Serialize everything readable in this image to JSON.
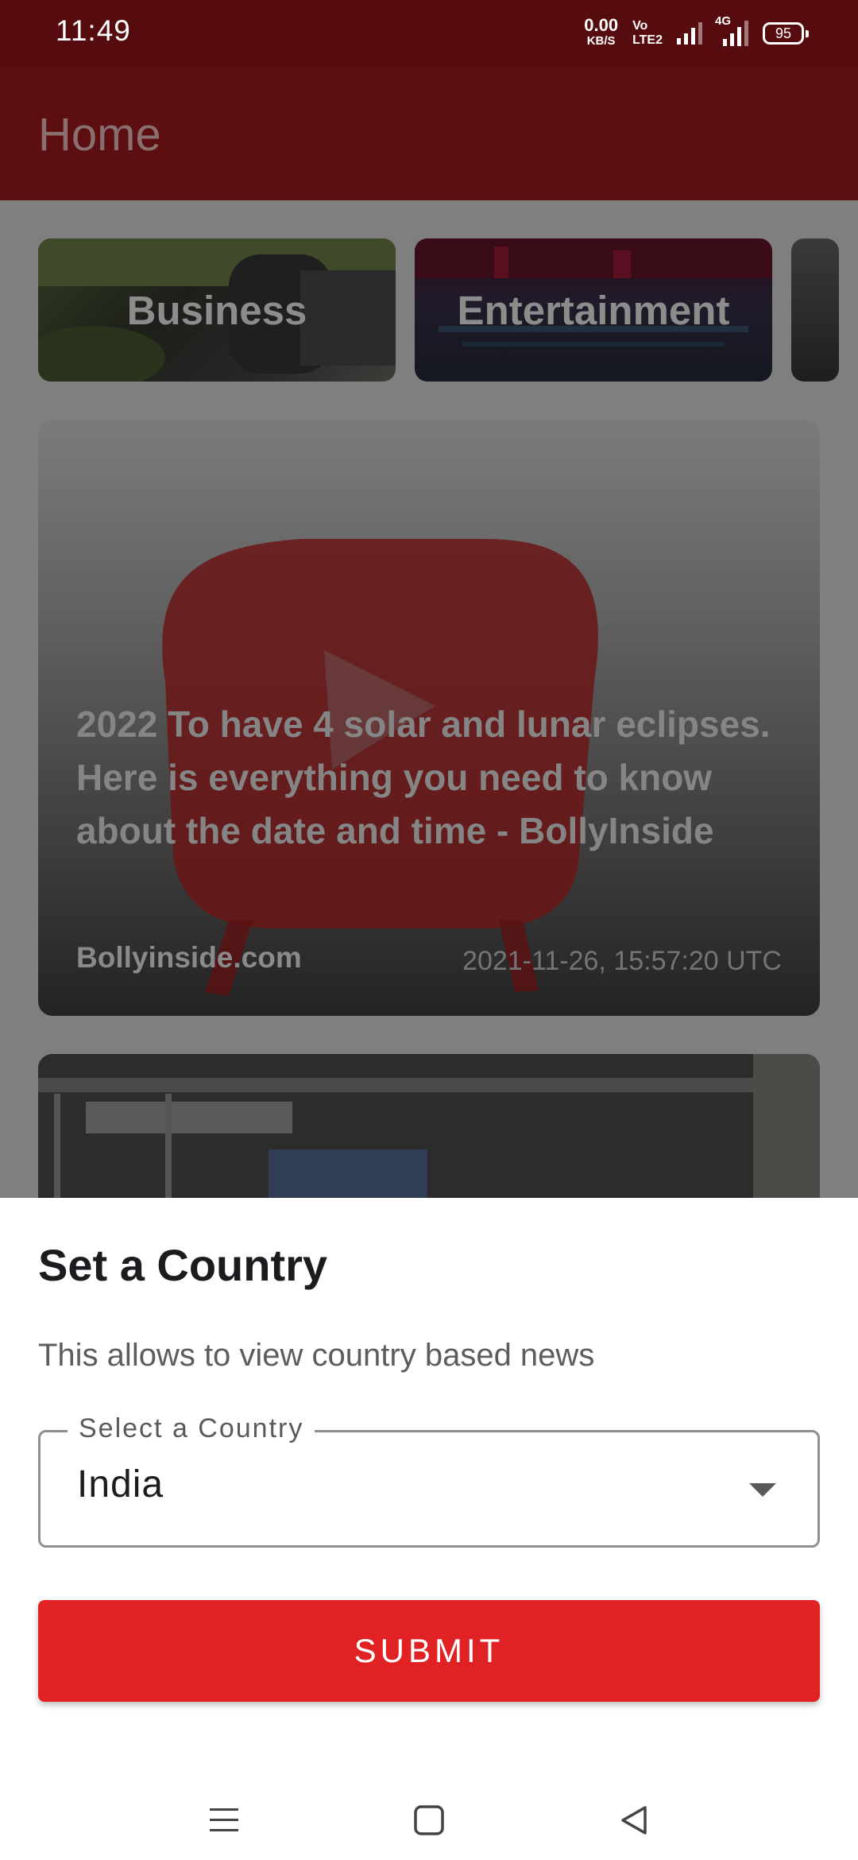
{
  "status_bar": {
    "time": "11:49",
    "speed_value": "0.00",
    "speed_unit": "KB/S",
    "volte_line1": "Vo",
    "volte_line2": "LTE2",
    "network_type": "4G",
    "battery": "95"
  },
  "app_bar": {
    "title": "Home"
  },
  "categories": [
    {
      "label": "Business"
    },
    {
      "label": "Entertainment"
    }
  ],
  "featured_article": {
    "title": "2022 To have 4 solar and lunar eclipses. Here is everything you need to know about the date and time - BollyInside",
    "source": "Bollyinside.com",
    "published": "2021-11-26, 15:57:20 UTC"
  },
  "country_sheet": {
    "title": "Set a Country",
    "subtitle": "This allows to view country based news",
    "field_label": "Select a Country",
    "selected_country": "India",
    "submit_label": "SUBMIT"
  },
  "colors": {
    "status_bar": "#560c0e",
    "app_bar": "#5d0e10",
    "accent": "#e02224",
    "scrim": "#7f7f7f"
  },
  "icons": {
    "nav_menu": "menu-icon",
    "nav_home": "home-square-icon",
    "nav_back": "back-triangle-icon",
    "dropdown": "dropdown-arrow-icon"
  }
}
